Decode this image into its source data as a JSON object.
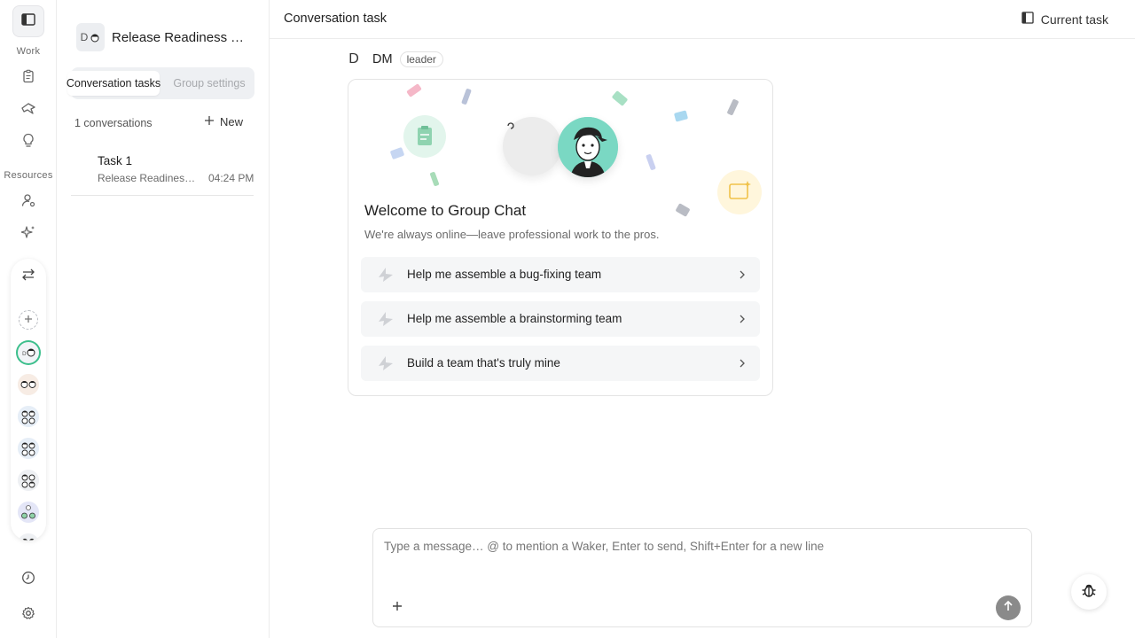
{
  "rail": {
    "sections": {
      "work": "Work",
      "resources": "Resources"
    },
    "icons": [
      "sidebar-toggle-icon",
      "clipboard-icon",
      "rocket-icon",
      "lightbulb-icon",
      "person-gear-icon",
      "sparkle-icon",
      "swap-icon",
      "add-icon",
      "clock-icon",
      "settings-icon"
    ]
  },
  "group": {
    "avatar_letter": "D",
    "title": "Release Readiness Te...",
    "tabs": {
      "active": "Conversation tasks",
      "inactive": "Group settings"
    },
    "conversation_count": "1 conversations",
    "new_label": "New"
  },
  "tasks": [
    {
      "title": "Task 1",
      "subtitle": "Release Readiness ...",
      "time": "04:24 PM"
    }
  ],
  "header": {
    "title": "Conversation task",
    "current_task_label": "Current task"
  },
  "message": {
    "avatar_letter": "D",
    "sender": "DM",
    "role": "leader"
  },
  "welcome": {
    "title": "Welcome to Group Chat",
    "subtitle": "We're always online—leave professional work to the pros.",
    "suggestions": [
      "Help me assemble a bug-fixing team",
      "Help me assemble a brainstorming team",
      "Build a team that's truly mine"
    ]
  },
  "composer": {
    "placeholder": "Type a message… @ to mention a Waker, Enter to send, Shift+Enter for a new line"
  },
  "colors": {
    "accent": "#3cbf8c",
    "bot_avatar": "#7ad8c3",
    "send_button": "#8a8a8a"
  }
}
